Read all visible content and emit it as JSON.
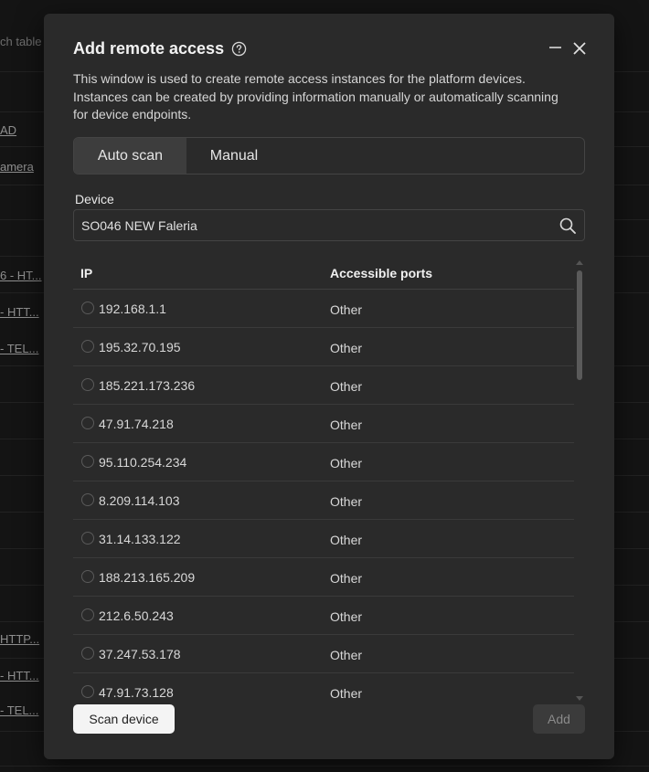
{
  "background": {
    "items": [
      {
        "text": "ch table",
        "plain": true
      },
      {
        "text": "AD"
      },
      {
        "text": "amera"
      },
      {
        "text": "6 - HT..."
      },
      {
        "text": "- HTT..."
      },
      {
        "text": "- TEL..."
      },
      {
        "text": " HTTP..."
      },
      {
        "text": "- HTT..."
      },
      {
        "text": "- TEL..."
      }
    ]
  },
  "modal": {
    "title": "Add remote access",
    "description": "This window is used to create remote access instances for the platform devices. Instances can be created by providing information manually or automatically scanning for device endpoints.",
    "tabs": [
      {
        "label": "Auto scan",
        "active": true
      },
      {
        "label": "Manual",
        "active": false
      }
    ],
    "device": {
      "label": "Device",
      "value": "SO046 NEW Faleria"
    },
    "table": {
      "columns": [
        "IP",
        "Accessible ports"
      ],
      "rows": [
        {
          "ip": "192.168.1.1",
          "ports": "Other"
        },
        {
          "ip": "195.32.70.195",
          "ports": "Other"
        },
        {
          "ip": "185.221.173.236",
          "ports": "Other"
        },
        {
          "ip": "47.91.74.218",
          "ports": "Other"
        },
        {
          "ip": "95.110.254.234",
          "ports": "Other"
        },
        {
          "ip": "8.209.114.103",
          "ports": "Other"
        },
        {
          "ip": "31.14.133.122",
          "ports": "Other"
        },
        {
          "ip": "188.213.165.209",
          "ports": "Other"
        },
        {
          "ip": "212.6.50.243",
          "ports": "Other"
        },
        {
          "ip": "37.247.53.178",
          "ports": "Other"
        },
        {
          "ip": "47.91.73.128",
          "ports": "Other"
        }
      ]
    },
    "actions": {
      "scan_label": "Scan device",
      "add_label": "Add"
    },
    "icons": {
      "help": "help-circle-icon",
      "minimize": "minimize-icon",
      "close": "close-icon",
      "search": "search-icon"
    }
  }
}
